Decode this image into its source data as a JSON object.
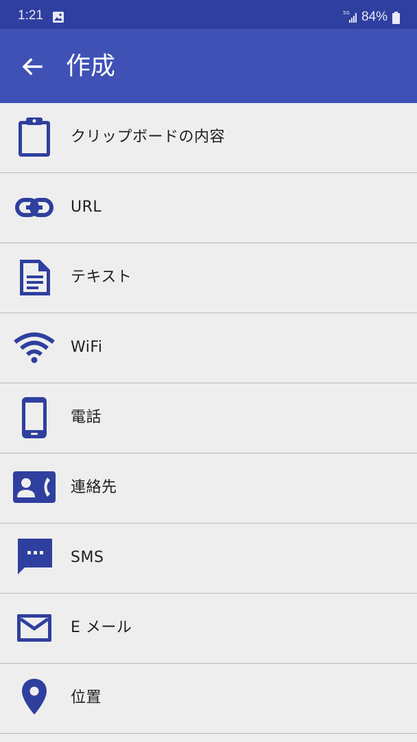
{
  "status_bar": {
    "time": "1:21",
    "network": "5G",
    "battery": "84%"
  },
  "app_bar": {
    "title": "作成",
    "back_icon": "arrow-back-icon"
  },
  "menu": {
    "items": [
      {
        "label": "クリップボードの内容",
        "icon": "clipboard-icon"
      },
      {
        "label": "URL",
        "icon": "link-icon"
      },
      {
        "label": "テキスト",
        "icon": "document-icon"
      },
      {
        "label": "WiFi",
        "icon": "wifi-icon"
      },
      {
        "label": "電話",
        "icon": "phone-icon"
      },
      {
        "label": "連絡先",
        "icon": "contact-card-icon"
      },
      {
        "label": "SMS",
        "icon": "sms-icon"
      },
      {
        "label": "E メール",
        "icon": "email-icon"
      },
      {
        "label": "位置",
        "icon": "location-pin-icon"
      }
    ]
  },
  "colors": {
    "status_bar": "#2f3fa0",
    "app_bar": "#3f51b5",
    "icon": "#2f3f9e",
    "background": "#eeeeee"
  }
}
